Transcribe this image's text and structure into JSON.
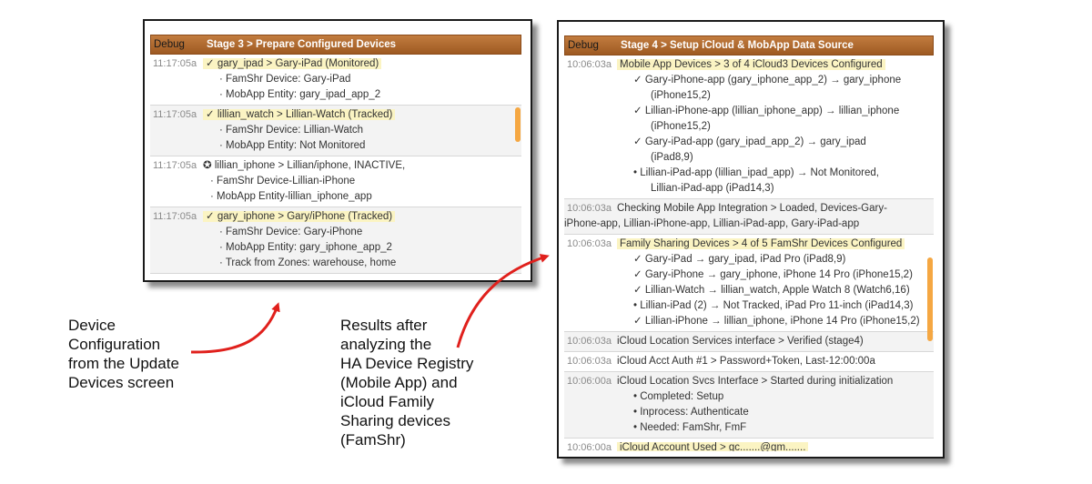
{
  "left_panel": {
    "debug_label": "Debug",
    "title": "Stage 3 > Prepare Configured Devices",
    "rows": [
      {
        "time": "11:17:05a",
        "main": "✓ gary_ipad > Gary-iPad (Monitored)",
        "subs": [
          "FamShr Device: Gary-iPad",
          "MobApp Entity: gary_ipad_app_2"
        ]
      },
      {
        "time": "11:17:05a",
        "main": "✓ lillian_watch > Lillian-Watch (Tracked)",
        "subs": [
          "FamShr Device: Lillian-Watch",
          "MobApp Entity: Not Monitored"
        ]
      },
      {
        "time": "11:17:05a",
        "main": "✪ lillian_iphone > Lillian/iphone, INACTIVE,",
        "subs": [
          "FamShr Device-Lillian-iPhone",
          "MobApp Entity-lillian_iphone_app"
        ]
      },
      {
        "time": "11:17:05a",
        "main": "✓ gary_iphone > Gary/iPhone (Tracked)",
        "subs": [
          "FamShr Device: Gary-iPhone",
          "MobApp Entity: gary_iphone_app_2",
          "Track from Zones: warehouse, home"
        ]
      }
    ]
  },
  "right_panel": {
    "debug_label": "Debug",
    "title": "Stage 4 > Setup iCloud & MobApp Data Source",
    "rows": [
      {
        "time": "10:06:03a",
        "main": "Mobile App Devices > 3 of 4 iCloud3 Devices Configured",
        "subs": [
          "✓ Gary-iPhone-app (gary_iphone_app_2) → gary_iphone",
          "(iPhone15,2)",
          "✓ Lillian-iPhone-app (lillian_iphone_app) → lillian_iphone",
          "(iPhone15,2)",
          "✓ Gary-iPad-app (gary_ipad_app_2) → gary_ipad",
          "(iPad8,9)",
          "• Lillian-iPad-app (lillian_ipad_app) → Not Monitored,",
          "Lillian-iPad-app (iPad14,3)"
        ]
      },
      {
        "time": "10:06:03a",
        "main": "Checking Mobile App Integration > Loaded, Devices-Gary-",
        "main2": "iPhone-app, Lillian-iPhone-app, Lillian-iPad-app, Gary-iPad-app",
        "subs": []
      },
      {
        "time": "10:06:03a",
        "main": "Family Sharing Devices > 4 of 5 FamShr Devices Configured",
        "subs": [
          "✓ Gary-iPad → gary_ipad, iPad Pro (iPad8,9)",
          "✓ Gary-iPhone → gary_iphone, iPhone 14 Pro (iPhone15,2)",
          "✓ Lillian-Watch → lillian_watch, Apple Watch 8 (Watch6,16)",
          "• Lillian-iPad (2) → Not Tracked, iPad Pro 11-inch (iPad14,3)",
          "✓ Lillian-iPhone → lillian_iphone, iPhone 14 Pro (iPhone15,2)"
        ]
      },
      {
        "time": "10:06:03a",
        "main": "iCloud Location Services interface > Verified (stage4)",
        "subs": []
      },
      {
        "time": "10:06:03a",
        "main": "iCloud Acct Auth #1 > Password+Token, Last-12:00:00a",
        "subs": []
      },
      {
        "time": "10:06:00a",
        "main": "iCloud Location Svcs Interface > Started during initialization",
        "subs": [
          "• Completed: Setup",
          "• Inprocess: Authenticate",
          "• Needed: FamShr, FmF"
        ]
      },
      {
        "time": "10:06:00a",
        "main": "iCloud Account Used > gc.......@gm.......",
        "subs": []
      }
    ]
  },
  "notes": {
    "left_lines": [
      "Device",
      "Configuration",
      "from the Update",
      "Devices screen"
    ],
    "right_lines": [
      "Results after",
      "analyzing the",
      "HA Device Registry",
      "(Mobile App) and",
      "iCloud Family",
      "Sharing devices",
      "(FamShr)"
    ]
  },
  "colors": {
    "header": "#b06b2e",
    "highlight": "#fbf4c3",
    "scrollbar": "#f5a742",
    "arrow": "#e0201c"
  }
}
